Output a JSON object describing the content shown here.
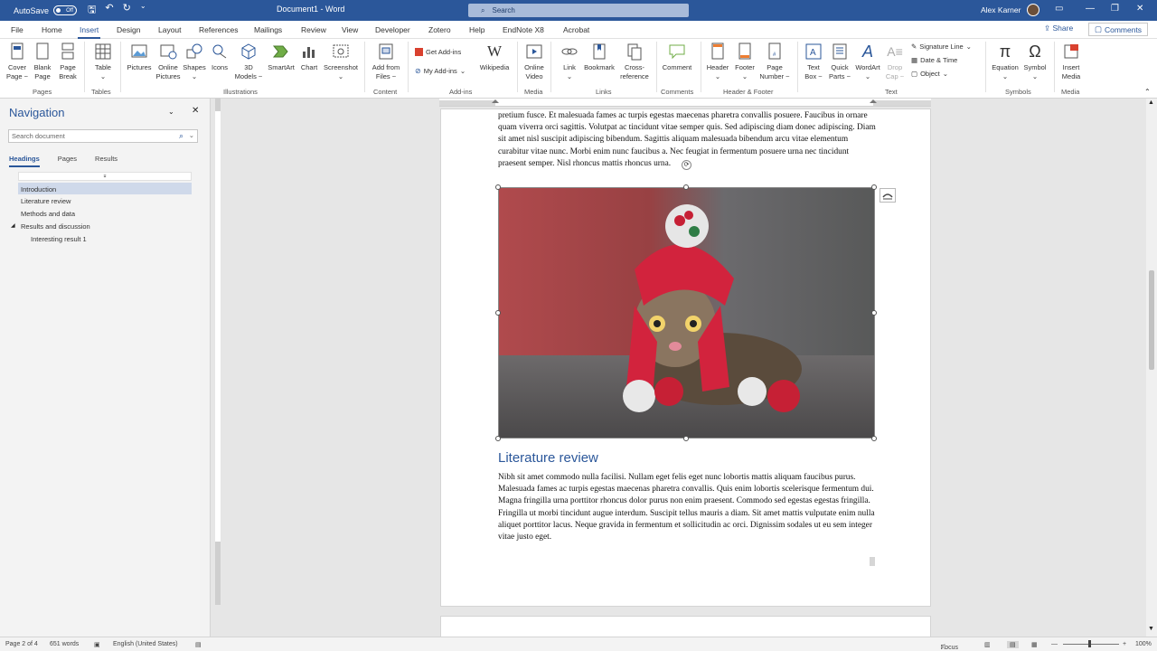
{
  "titlebar": {
    "autosave_label": "AutoSave",
    "autosave_state": "Off",
    "document_title": "Document1  -  Word",
    "search_placeholder": "Search",
    "user_name": "Alex Karner"
  },
  "menu": {
    "tabs": [
      "File",
      "Home",
      "Insert",
      "Design",
      "Layout",
      "References",
      "Mailings",
      "Review",
      "View",
      "Developer",
      "Zotero",
      "Help",
      "EndNote X8",
      "Acrobat"
    ],
    "active_tab": "Insert",
    "share_label": "Share",
    "comments_label": "Comments"
  },
  "ribbon": {
    "pages": {
      "cover_page": [
        "Cover",
        "Page ~"
      ],
      "blank_page": [
        "Blank",
        "Page"
      ],
      "page_break": [
        "Page",
        "Break"
      ],
      "label": "Pages"
    },
    "tables": {
      "table": "Table",
      "label": "Tables"
    },
    "illustrations": {
      "pictures": "Pictures",
      "online_pictures": [
        "Online",
        "Pictures"
      ],
      "shapes": "Shapes",
      "icons": "Icons",
      "models_3d": [
        "3D",
        "Models ~"
      ],
      "smartart": "SmartArt",
      "chart": "Chart",
      "screenshot": "Screenshot",
      "label": "Illustrations"
    },
    "content": {
      "add_from_files": [
        "Add from",
        "Files ~"
      ],
      "label": "Content"
    },
    "addins": {
      "get_addins": "Get Add-ins",
      "my_addins": "My Add-ins",
      "wikipedia": "Wikipedia",
      "label": "Add-ins"
    },
    "media": {
      "online_video": [
        "Online",
        "Video"
      ],
      "label": "Media"
    },
    "links": {
      "link": "Link",
      "bookmark": "Bookmark",
      "cross_reference": [
        "Cross-",
        "reference"
      ],
      "label": "Links"
    },
    "comments": {
      "comment": "Comment",
      "label": "Comments"
    },
    "header_footer": {
      "header": "Header",
      "footer": "Footer",
      "page_number": [
        "Page",
        "Number ~"
      ],
      "label": "Header & Footer"
    },
    "text": {
      "text_box": [
        "Text",
        "Box ~"
      ],
      "quick_parts": [
        "Quick",
        "Parts ~"
      ],
      "wordart": "WordArt",
      "drop_cap": [
        "Drop",
        "Cap ~"
      ],
      "signature_line": "Signature Line",
      "date_time": "Date & Time",
      "object": "Object",
      "label": "Text"
    },
    "symbols": {
      "equation": "Equation",
      "symbol": "Symbol",
      "label": "Symbols"
    },
    "media2": {
      "insert_media": [
        "Insert",
        "Media"
      ],
      "label": "Media"
    }
  },
  "navigation": {
    "title": "Navigation",
    "search_placeholder": "Search document",
    "tabs": [
      "Headings",
      "Pages",
      "Results"
    ],
    "items": [
      {
        "label": "Introduction",
        "level": 1,
        "selected": true
      },
      {
        "label": "Literature review",
        "level": 1,
        "selected": false
      },
      {
        "label": "Methods and data",
        "level": 1,
        "selected": false
      },
      {
        "label": "Results and discussion",
        "level": 1,
        "selected": false,
        "expanded": true
      },
      {
        "label": "Interesting result 1",
        "level": 2,
        "selected": false
      }
    ]
  },
  "document": {
    "paragraph1": "pretium fusce. Et malesuada fames ac turpis egestas maecenas pharetra convallis posuere. Faucibus in ornare quam viverra orci sagittis. Volutpat ac tincidunt vitae semper quis. Sed adipiscing diam donec adipiscing. Diam sit amet nisl suscipit adipiscing bibendum. Sagittis aliquam malesuada bibendum arcu vitae elementum curabitur vitae nunc. Morbi enim nunc faucibus a. Nec feugiat in fermentum posuere urna nec tincidunt praesent semper. Nisl rhoncus mattis rhoncus urna.",
    "heading": "Literature review",
    "paragraph2": "Nibh sit amet commodo nulla facilisi. Nullam eget felis eget nunc lobortis mattis aliquam faucibus purus. Malesuada fames ac turpis egestas maecenas pharetra convallis. Quis enim lobortis scelerisque fermentum dui. Magna fringilla urna porttitor rhoncus dolor purus non enim praesent. Commodo sed egestas egestas fringilla. Fringilla ut morbi tincidunt augue interdum. Suscipit tellus mauris a diam. Sit amet mattis vulputate enim nulla aliquet porttitor lacus. Neque gravida in fermentum et sollicitudin ac orci. Dignissim sodales ut eu sem integer vitae justo eget."
  },
  "statusbar": {
    "page": "Page 2 of 4",
    "words": "651 words",
    "language": "English (United States)",
    "focus": "Focus",
    "zoom": "100%"
  },
  "colors": {
    "brand": "#2b579a"
  }
}
